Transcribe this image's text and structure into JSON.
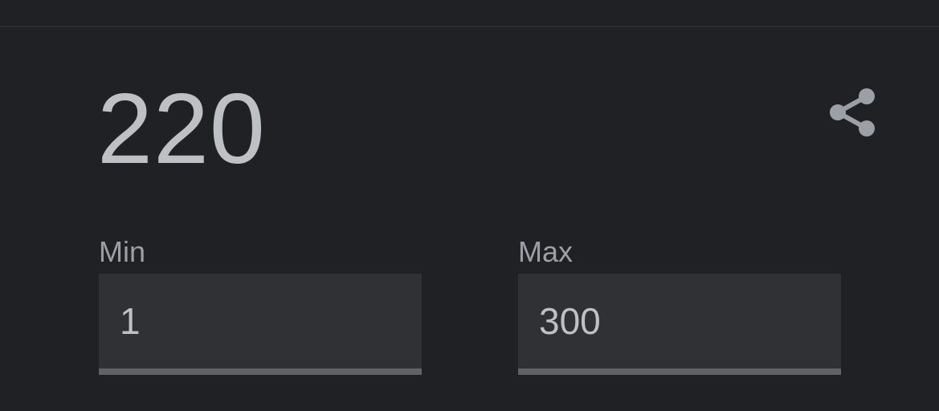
{
  "generator": {
    "result": "220",
    "share_icon": "share-icon",
    "min": {
      "label": "Min",
      "value": "1"
    },
    "max": {
      "label": "Max",
      "value": "300"
    }
  },
  "colors": {
    "background": "#202124",
    "text_primary": "#bdc1c6",
    "text_secondary": "#9aa0a6",
    "field_background": "#303134",
    "field_underline": "#5f6368"
  }
}
